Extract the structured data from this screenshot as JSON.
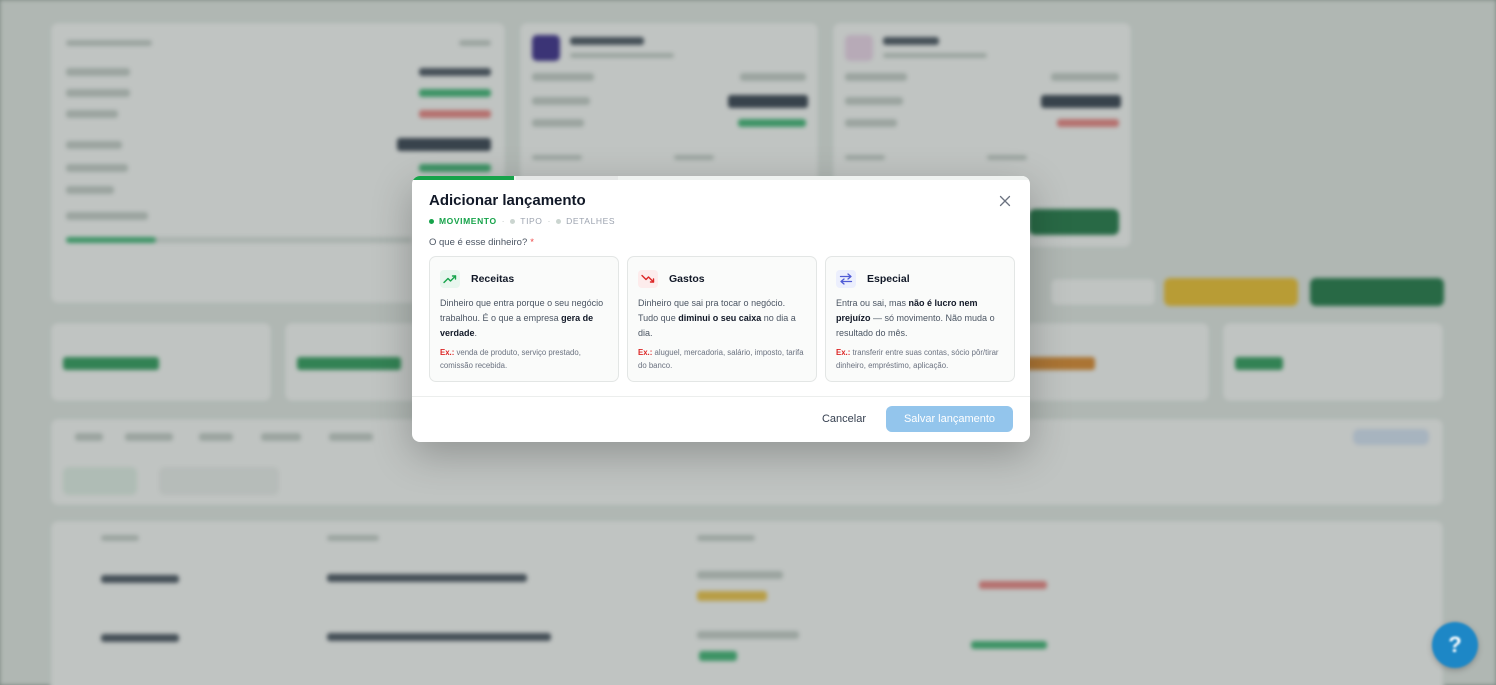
{
  "modal": {
    "title": "Adicionar lançamento",
    "steps": [
      "MOVIMENTO",
      "TIPO",
      "DETALHES"
    ],
    "active_step": "MOVIMENTO",
    "question": "O que é esse dinheiro?",
    "required_mark": "*",
    "options": [
      {
        "title": "Receitas",
        "icon": "trending-up-icon",
        "color": "#16a34a",
        "desc_1": "Dinheiro que entra porque o seu negócio trabalhou. É o que a empresa ",
        "desc_bold": "gera de verdade",
        "desc_2": ".",
        "ex_label": "Ex.:",
        "ex_text": "venda de produto, serviço prestado, comissão recebida."
      },
      {
        "title": "Gastos",
        "icon": "trending-down-icon",
        "color": "#dc2626",
        "desc_1": "Dinheiro que sai pra tocar o negócio. Tudo que ",
        "desc_bold": "diminui o seu caixa",
        "desc_2": " no dia a dia.",
        "ex_label": "Ex.:",
        "ex_text": "aluguel, mercadoria, salário, imposto, tarifa do banco."
      },
      {
        "title": "Especial",
        "icon": "swap-arrows-icon",
        "color": "#4f5bd5",
        "desc_1": "Entra ou sai, mas ",
        "desc_bold": "não é lucro nem prejuízo",
        "desc_2": " — só movimento. Não muda o resultado do mês.",
        "ex_label": "Ex.:",
        "ex_text": "transferir entre suas contas, sócio pôr/tirar dinheiro, empréstimo, aplicação."
      }
    ],
    "cancel_label": "Cancelar",
    "save_label": "Salvar lançamento",
    "save_color": "#93c5ec"
  },
  "help_label": "?"
}
